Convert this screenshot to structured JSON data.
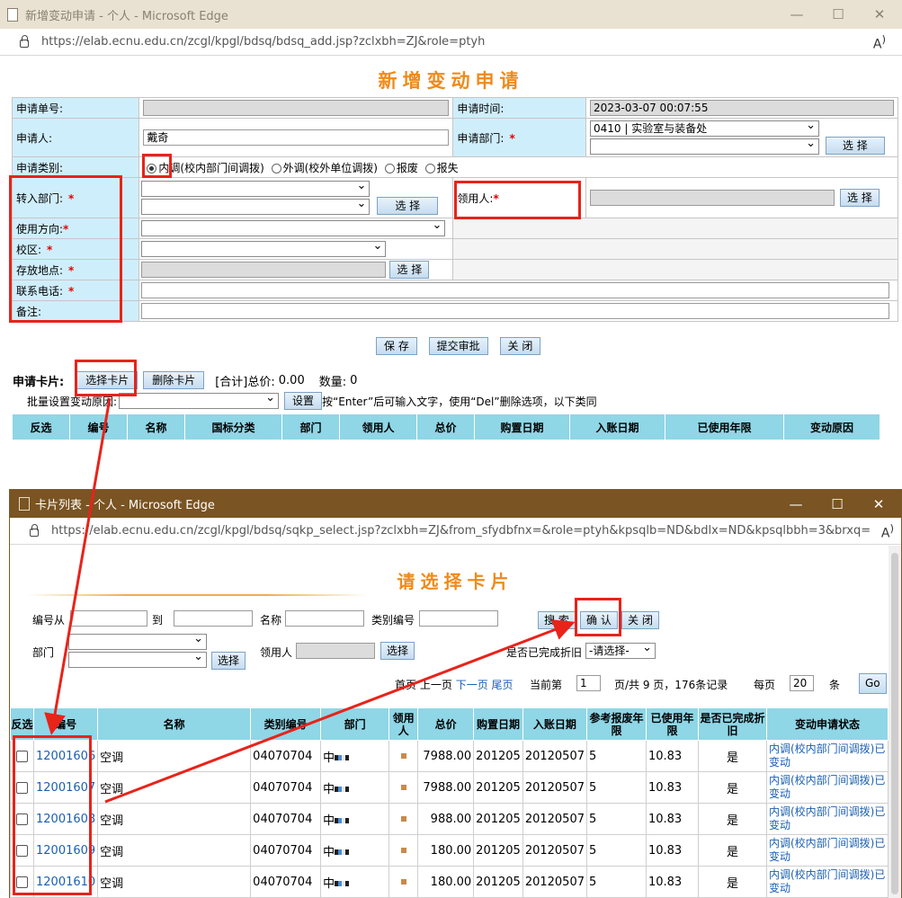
{
  "main": {
    "title": "新增变动申请 - 个人 - Microsoft Edge",
    "url": "https://elab.ecnu.edu.cn/zcgl/kpgl/bdsq/bdsq_add.jsp?zclxbh=ZJ&role=ptyh",
    "page_title": "新增变动申请",
    "form": {
      "apply_no_label": "申请单号:",
      "apply_time_label": "申请时间:",
      "apply_time_value": "2023-03-07 00:07:55",
      "applicant_label": "申请人:",
      "applicant_value": "戴奇",
      "apply_dept_label": "申请部门:",
      "apply_dept_value": "0410 | 实验室与装备处",
      "select_btn": "选 择",
      "category_label": "申请类别:",
      "category_options": [
        "内调(校内部门间调拨)",
        "外调(校外单位调拨)",
        "报废",
        "报失"
      ],
      "into_dept_label": "转入部门:",
      "receiver_label": "领用人:",
      "direction_label": "使用方向:",
      "campus_label": "校区:",
      "location_label": "存放地点:",
      "phone_label": "联系电话:",
      "remark_label": "备注:"
    },
    "actions": {
      "save": "保 存",
      "submit": "提交审批",
      "close": "关 闭"
    },
    "cards": {
      "label": "申请卡片:",
      "select_btn": "选择卡片",
      "delete_btn": "删除卡片",
      "summary_prefix": "[合计]总价:",
      "total": "0.00",
      "count_label": "数量:",
      "count": "0",
      "batch_label": "批量设置变动原因:",
      "set_btn": "设置",
      "hint": "按“Enter”后可输入文字，使用“Del”删除选项，以下类同",
      "columns": [
        "反选",
        "编号",
        "名称",
        "国标分类",
        "部门",
        "领用人",
        "总价",
        "购置日期",
        "入账日期",
        "已使用年限",
        "变动原因"
      ]
    }
  },
  "popup": {
    "title": "卡片列表 - 个人 - Microsoft Edge",
    "url": "https://elab.ecnu.edu.cn/zcgl/kpgl/bdsq/sqkp_select.jsp?zclxbh=ZJ&from_sfydbfnx=&role=ptyh&kpsqlb=ND&bdlx=ND&kpsqlbbh=3&brxq=",
    "page_title": "请选择卡片",
    "filters": {
      "no_from": "编号从",
      "to": "到",
      "name": "名称",
      "cat_no": "类别编号",
      "dept": "部门",
      "select_btn": "选择",
      "receiver": "领用人",
      "completed": "是否已完成折旧",
      "completed_value": "-请选择-",
      "search_btn": "搜 索",
      "confirm_btn": "确 认",
      "close_btn": "关 闭"
    },
    "pager": {
      "first": "首页",
      "prev": "上一页",
      "next": "下一页",
      "last": "尾页",
      "current_label": "当前第",
      "current": "1",
      "info": "页/共 9 页，176条记录",
      "per_page_label": "每页",
      "per_page": "20",
      "unit": "条",
      "go": "Go"
    },
    "columns": [
      "反选",
      "编号",
      "名称",
      "类别编号",
      "部门",
      "领用人",
      "总价",
      "购置日期",
      "入账日期",
      "参考报废年限",
      "已使用年限",
      "是否已完成折旧",
      "变动申请状态"
    ],
    "rows": [
      {
        "no": "12001606",
        "name": "空调",
        "cat": "04070704",
        "dept": "中",
        "price": "7988.00",
        "buy": "201205",
        "entry": "20120507",
        "years": "5",
        "used": "10.83",
        "done": "是",
        "status": "内调(校内部门间调拨)已变动"
      },
      {
        "no": "12001607",
        "name": "空调",
        "cat": "04070704",
        "dept": "中",
        "price": "7988.00",
        "buy": "201205",
        "entry": "20120507",
        "years": "5",
        "used": "10.83",
        "done": "是",
        "status": "内调(校内部门间调拨)已变动"
      },
      {
        "no": "12001608",
        "name": "空调",
        "cat": "04070704",
        "dept": "中",
        "price": "988.00",
        "buy": "201205",
        "entry": "20120507",
        "years": "5",
        "used": "10.83",
        "done": "是",
        "status": "内调(校内部门间调拨)已变动"
      },
      {
        "no": "12001609",
        "name": "空调",
        "cat": "04070704",
        "dept": "中",
        "price": "180.00",
        "buy": "201205",
        "entry": "20120507",
        "years": "5",
        "used": "10.83",
        "done": "是",
        "status": "内调(校内部门间调拨)已变动"
      },
      {
        "no": "12001610",
        "name": "空调",
        "cat": "04070704",
        "dept": "中",
        "price": "180.00",
        "buy": "201205",
        "entry": "20120507",
        "years": "5",
        "used": "10.83",
        "done": "是",
        "status": "内调(校内部门间调拨)已变动"
      }
    ]
  },
  "colors": {
    "accent_orange": "#f08a1a",
    "header_blue": "#8fd6e6",
    "label_blue": "#cfeefb",
    "annotation_red": "#e8231a"
  }
}
